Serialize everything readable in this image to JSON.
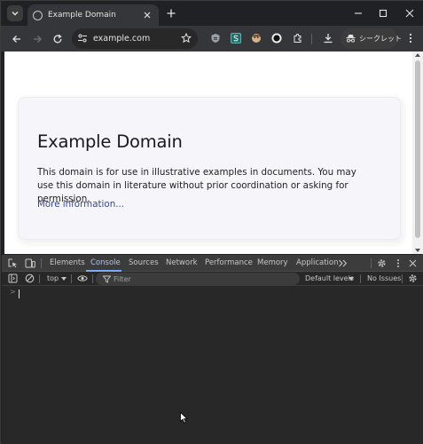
{
  "browser": {
    "tab_title": "Example Domain",
    "url": "example.com",
    "incognito_label": "シークレット"
  },
  "page": {
    "heading": "Example Domain",
    "paragraph": "This domain is for use in illustrative examples in documents. You may use this domain in literature without prior coordination or asking for permission.",
    "link": "More information..."
  },
  "devtools": {
    "tabs": [
      "Elements",
      "Console",
      "Sources",
      "Network",
      "Performance",
      "Memory",
      "Application"
    ],
    "active_tab": "Console",
    "context": "top",
    "filter_placeholder": "Filter",
    "levels": "Default levels",
    "issues": "No Issues",
    "prompt": ">"
  }
}
